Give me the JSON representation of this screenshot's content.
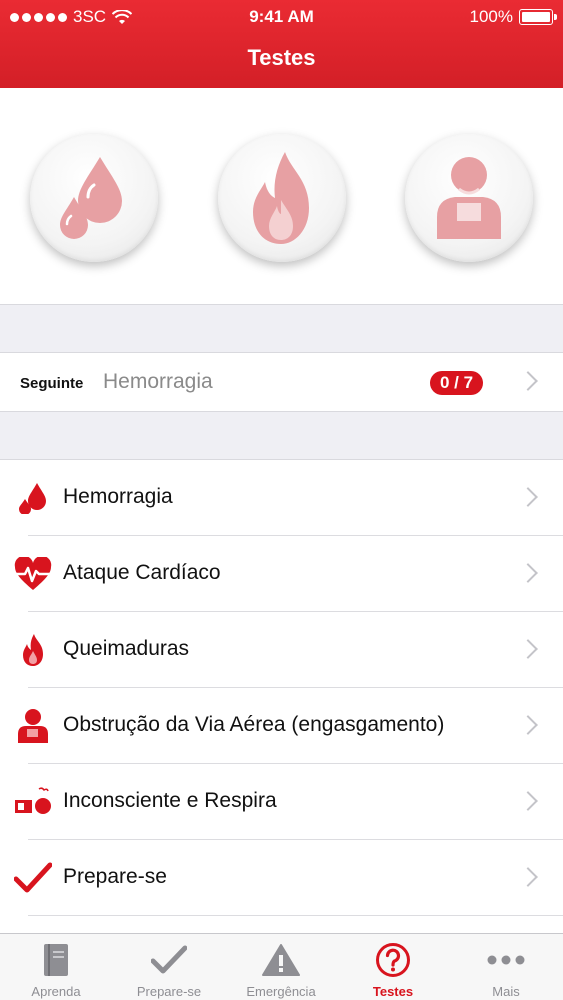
{
  "status_bar": {
    "carrier": "3SC",
    "time": "9:41 AM",
    "battery": "100%"
  },
  "nav": {
    "title": "Testes"
  },
  "categories": [
    {
      "icon": "blood-drops-icon"
    },
    {
      "icon": "flame-icon"
    },
    {
      "icon": "choking-person-icon"
    }
  ],
  "next": {
    "label": "Seguinte",
    "value": "Hemorragia",
    "progress": "0 / 7"
  },
  "list": [
    {
      "label": "Hemorragia",
      "icon": "blood-drop-icon"
    },
    {
      "label": "Ataque Cardíaco",
      "icon": "heart-pulse-icon"
    },
    {
      "label": "Queimaduras",
      "icon": "flame-icon"
    },
    {
      "label": "Obstrução da Via Aérea (engasgamento)",
      "icon": "choking-icon"
    },
    {
      "label": "Inconsciente e Respira",
      "icon": "unconscious-person-icon"
    },
    {
      "label": "Prepare-se",
      "icon": "checkmark-icon"
    }
  ],
  "tabs": [
    {
      "label": "Aprenda",
      "icon": "book-icon"
    },
    {
      "label": "Prepare-se",
      "icon": "checkmark-icon"
    },
    {
      "label": "Emergência",
      "icon": "warning-triangle-icon"
    },
    {
      "label": "Testes",
      "icon": "question-circle-icon",
      "active": true
    },
    {
      "label": "Mais",
      "icon": "more-dots-icon"
    }
  ],
  "colors": {
    "accent": "#d8141e",
    "header": "#e0232b",
    "separator": "#efeff4"
  }
}
